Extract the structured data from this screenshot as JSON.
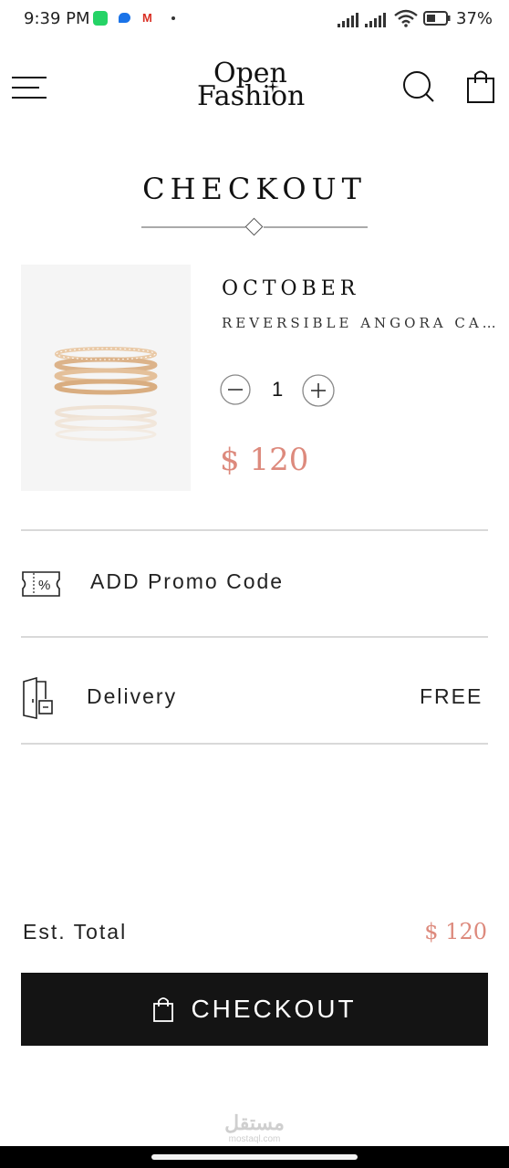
{
  "status_bar": {
    "time": "9:39 PM",
    "gmail_letter": "M",
    "battery": "37%"
  },
  "header": {
    "logo_line1": "Open",
    "logo_line2": "Fashion",
    "icons": [
      "menu-icon",
      "search-icon",
      "bag-icon"
    ]
  },
  "page": {
    "title": "CHECKOUT"
  },
  "product": {
    "brand": "OCTOBER",
    "description": "REVERSIBLE ANGORA CARDIGAN",
    "quantity": "1",
    "price": "$ 120"
  },
  "promo": {
    "label": "ADD Promo Code",
    "icon_text": "%"
  },
  "delivery": {
    "label": "Delivery",
    "value": "FREE"
  },
  "total": {
    "label": "Est. Total",
    "value": "$ 120"
  },
  "checkout_button": {
    "label": "CHECKOUT"
  },
  "watermark": {
    "text": "مستقل",
    "sub": "mostaql.com"
  },
  "colors": {
    "accent_price": "#dd8a7d",
    "button_bg": "#141414",
    "divider": "#d9d9d9"
  }
}
